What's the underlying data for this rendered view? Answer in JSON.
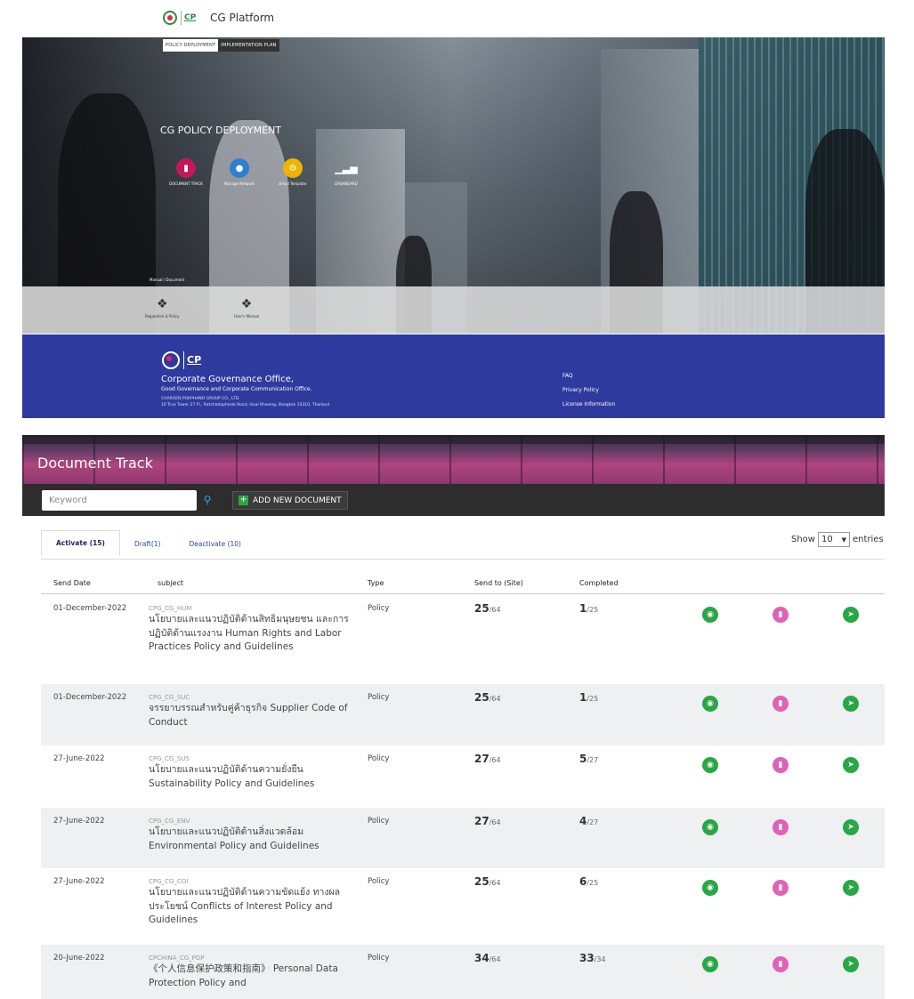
{
  "header": {
    "brand": "CG Platform",
    "logo_text": "CP"
  },
  "hero": {
    "tabs": [
      "POLICY DEPLOYMENT",
      "IMPLEMENTATION PLAN"
    ],
    "title": "CG POLICY DEPLOYMENT",
    "tiles": [
      {
        "label": "DOCUMENT TRACK",
        "icon": "bookmark-icon",
        "color": "#c2185b"
      },
      {
        "label": "Manage Network",
        "icon": "users-icon",
        "color": "#2f7fd0"
      },
      {
        "label": "Email Template",
        "icon": "gears-icon",
        "color": "#f0b400"
      },
      {
        "label": "DASHBOARD",
        "icon": "bar-chart-icon",
        "color": "transparent"
      }
    ],
    "manual_label": "Manual / Document",
    "manuals": [
      "Regulation & Policy",
      "User's Manual"
    ]
  },
  "footer": {
    "logo_text": "CP",
    "org": "Corporate Governance Office,",
    "sub": "Good Governance and Corporate Communication Office.",
    "company": "CHAROEN POKPHAND GROUP CO., LTD.",
    "address": "10 True Tower 27 Fl., Ratchadaphisek Road, Huai Khwang, Bangkok 10310, Thailand",
    "links": [
      "FAQ",
      "Privacy Policy",
      "License Information"
    ]
  },
  "doc_track": {
    "title": "Document Track",
    "search_placeholder": "Keyword",
    "add_label": "ADD NEW DOCUMENT",
    "tabs": [
      "Activate (15)",
      "Draft(1)",
      "Deactivate (10)"
    ],
    "show_label": "Show",
    "show_value": "10",
    "entries_label": "entries",
    "columns": [
      "Send Date",
      "subject",
      "Type",
      "Send to (Site)",
      "Completed"
    ],
    "rows": [
      {
        "date": "01-December-2022",
        "code": "CPG_CG_HUM",
        "name": "นโยบายและแนวปฏิบัติด้านสิทธิมนุษยชน และการปฏิบัติด้านแรงงาน Human Rights and Labor Practices Policy and Guidelines",
        "type": "Policy",
        "sent": "25",
        "sent_total": "/64",
        "completed": "1",
        "completed_total": "/25"
      },
      {
        "date": "01-December-2022",
        "code": "CPG_CG_SUC",
        "name": "จรรยาบรรณสำหรับคู่ค้าธุรกิจ Supplier Code of Conduct",
        "type": "Policy",
        "sent": "25",
        "sent_total": "/64",
        "completed": "1",
        "completed_total": "/25"
      },
      {
        "date": "27-June-2022",
        "code": "CPG_CG_SUS",
        "name": "นโยบายและแนวปฏิบัติด้านความยั่งยืน Sustainability Policy and Guidelines",
        "type": "Policy",
        "sent": "27",
        "sent_total": "/64",
        "completed": "5",
        "completed_total": "/27"
      },
      {
        "date": "27-June-2022",
        "code": "CPG_CG_ENV",
        "name": "นโยบายและแนวปฏิบัติด้านสิ่งแวดล้อม Environmental Policy and Guidelines",
        "type": "Policy",
        "sent": "27",
        "sent_total": "/64",
        "completed": "4",
        "completed_total": "/27"
      },
      {
        "date": "27-June-2022",
        "code": "CPG_CG_COI",
        "name": "นโยบายและแนวปฏิบัติด้านความขัดแย้ง ทางผลประโยชน์ Conflicts of Interest Policy and Guidelines",
        "type": "Policy",
        "sent": "25",
        "sent_total": "/64",
        "completed": "6",
        "completed_total": "/25"
      },
      {
        "date": "20-June-2022",
        "code": "CPCHINA_CG_PDP",
        "name": "《个人信息保护政策和指南》 Personal Data Protection Policy and",
        "type": "Policy",
        "sent": "34",
        "sent_total": "/64",
        "completed": "33",
        "completed_total": "/34"
      }
    ]
  }
}
